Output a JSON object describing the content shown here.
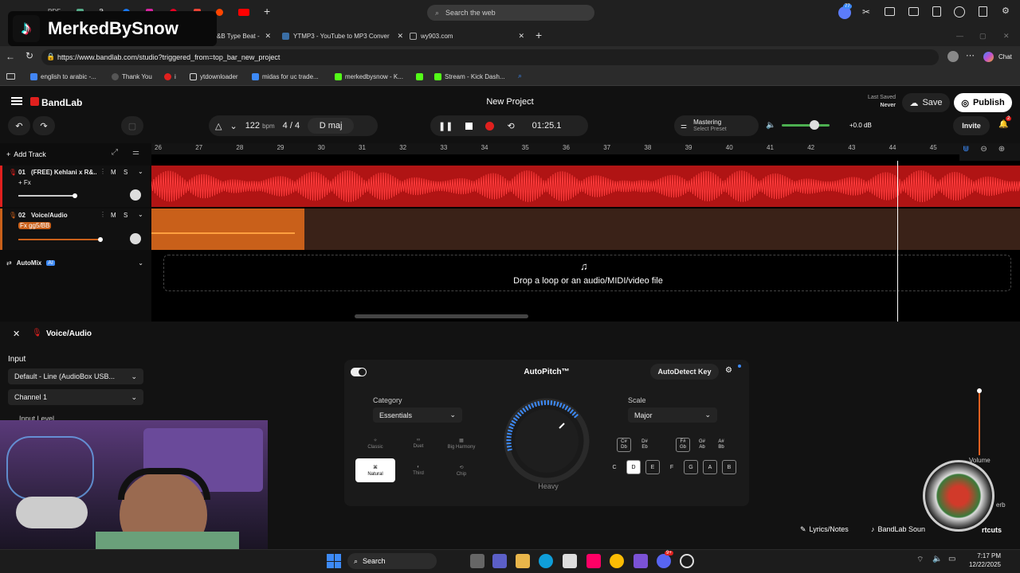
{
  "overlay": {
    "channel_name": "MerkedBySnow"
  },
  "browser": {
    "search_placeholder": "Search the web",
    "tabs": [
      {
        "label": "&B Type Beat - "
      },
      {
        "label": "YTMP3 - YouTube to MP3 Conver"
      },
      {
        "label": "wy903.com"
      }
    ],
    "url": "https://www.bandlab.com/studio?triggered_from=top_bar_new_project",
    "badge_count": "77",
    "chat_label": "Chat",
    "favorites": [
      {
        "label": "english to arabic -..."
      },
      {
        "label": "Thank You"
      },
      {
        "label": "i"
      },
      {
        "label": "ytdownloader"
      },
      {
        "label": "midas for uc trade..."
      },
      {
        "label": "merkedbysnow - K..."
      },
      {
        "label": "Stream - Kick Dash..."
      }
    ],
    "pdf_label": "PDF"
  },
  "bandlab": {
    "logo": "BandLab",
    "project_title": "New Project",
    "last_saved_label": "Last Saved",
    "last_saved_value": "Never",
    "save_label": "Save",
    "publish_label": "Publish",
    "invite_label": "Invite",
    "notification_count": "2",
    "bpm": "122",
    "bpm_unit": "bpm",
    "time_sig_num": "4",
    "time_sig_sep": "/",
    "time_sig_den": "4",
    "key": "D maj",
    "time": "01:25.1",
    "mastering_label": "Mastering",
    "mastering_preset": "Select Preset",
    "master_volume": "+0.0 dB",
    "add_track_label": "Add Track",
    "ruler": [
      "26",
      "27",
      "28",
      "29",
      "30",
      "31",
      "32",
      "33",
      "34",
      "35",
      "36",
      "37",
      "38",
      "39",
      "40",
      "41",
      "42",
      "43",
      "44",
      "45"
    ],
    "tracks": [
      {
        "number": "01",
        "name": "(FREE) Kehlani x R&...",
        "fx": "+ Fx",
        "mute": "M",
        "solo": "S"
      },
      {
        "number": "02",
        "name": "Voice/Audio",
        "fx": "Fx gg5/BB",
        "mute": "M",
        "solo": "S"
      }
    ],
    "automix_label": "AutoMix",
    "ai_badge": "AI",
    "drop_text": "Drop a loop or an audio/MIDI/video file",
    "bottom_track_name": "Voice/Audio",
    "input_label": "Input",
    "input_device": "Default - Line (AudioBox USB...",
    "channel": "Channel 1",
    "input_level_label": "Input Level",
    "autopitch_title": "AutoPitch™",
    "autodetect_label": "AutoDetect Key",
    "category_label": "Category",
    "category_value": "Essentials",
    "modes": [
      {
        "label": "Classic"
      },
      {
        "label": "Duet"
      },
      {
        "label": "Big Harmony"
      },
      {
        "label": "Natural"
      },
      {
        "label": "Third"
      },
      {
        "label": "Chip"
      }
    ],
    "knob_label": "Heavy",
    "scale_label": "Scale",
    "scale_value": "Major",
    "sharp_keys": [
      {
        "top": "C#",
        "bottom": "Db"
      },
      {
        "top": "D#",
        "bottom": "Eb"
      },
      {
        "top": "F#",
        "bottom": "Gb"
      },
      {
        "top": "G#",
        "bottom": "Ab"
      },
      {
        "top": "A#",
        "bottom": "Bb"
      }
    ],
    "natural_keys": [
      "C",
      "D",
      "E",
      "F",
      "G",
      "A",
      "B"
    ],
    "volume_label": "Volume",
    "reverb_label": "erb",
    "lyrics_label": "Lyrics/Notes",
    "sounds_label": "BandLab Soun",
    "shortcuts_label": "rtcuts"
  },
  "taskbar": {
    "search_label": "Search",
    "time": "7:17 PM",
    "date": "12/22/2025",
    "chat_badge": "9+"
  },
  "colors": {
    "accent": "#e0201e",
    "track_audio": "#c9601a",
    "blue": "#3d8af7"
  }
}
